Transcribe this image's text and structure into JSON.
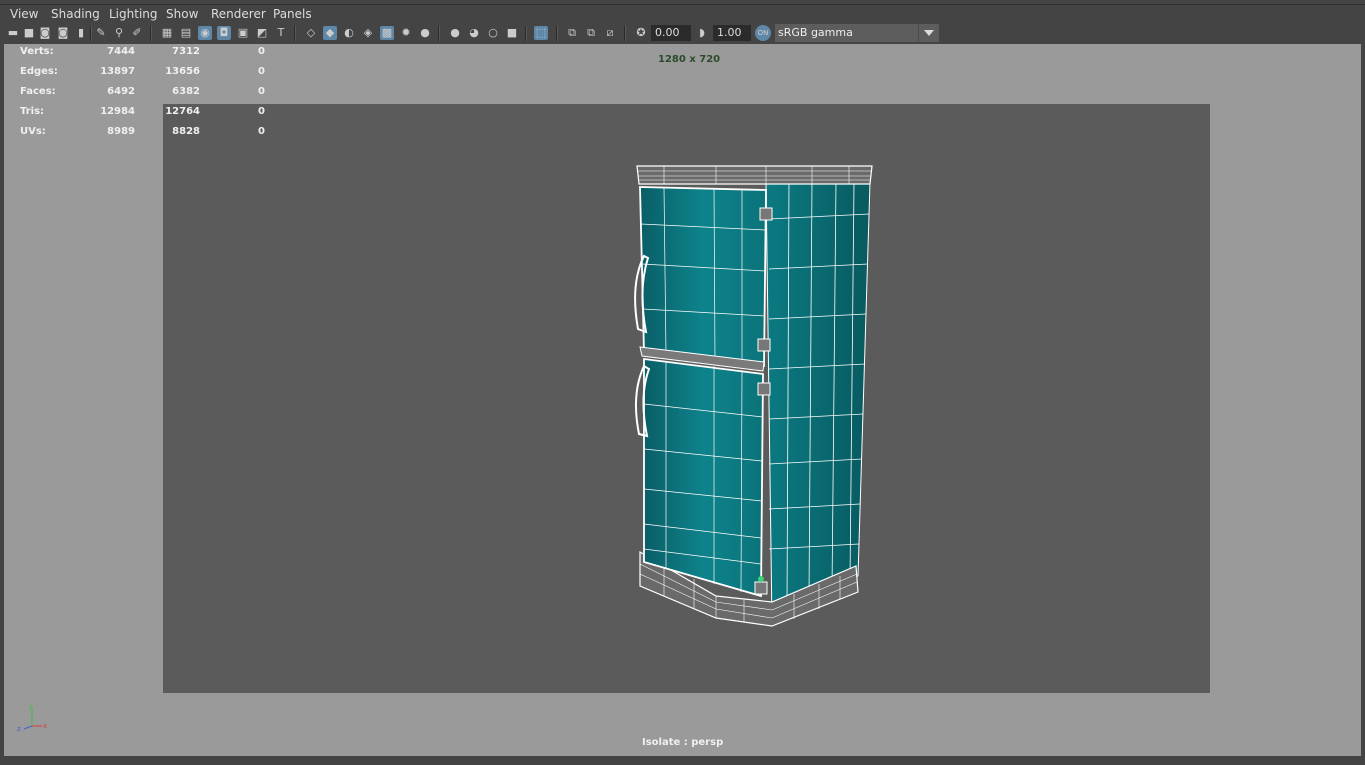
{
  "menu": [
    "View",
    "Shading",
    "Lighting",
    "Show",
    "Renderer",
    "Panels"
  ],
  "toolbar": {
    "exposure_value": "0.00",
    "gamma_value": "1.00",
    "colorspace": "sRGB gamma",
    "icons": [
      "camera-icon",
      "camera-attributes-icon",
      "bookmark-icon",
      "image-plane-icon",
      "grid-icon",
      "film-gate-icon",
      "resolution-gate-icon",
      "safe-action-icon",
      "wireframe-icon",
      "smooth-shade-icon",
      "textured-icon",
      "lights-icon",
      "shadows-icon",
      "xray-icon",
      "isolate-icon",
      "color-management-icon"
    ]
  },
  "hud": {
    "rows": [
      {
        "label": "Verts:",
        "total": "7444",
        "selected": "7312",
        "extra": "0"
      },
      {
        "label": "Edges:",
        "total": "13897",
        "selected": "13656",
        "extra": "0"
      },
      {
        "label": "Faces:",
        "total": "6492",
        "selected": "6382",
        "extra": "0"
      },
      {
        "label": "Tris:",
        "total": "12984",
        "selected": "12764",
        "extra": "0"
      },
      {
        "label": "UVs:",
        "total": "8989",
        "selected": "8828",
        "extra": "0"
      }
    ],
    "resolution": "1280 x 720",
    "camera": "Isolate : persp"
  },
  "colors": {
    "viewport_bg": "#9a9a9a",
    "gate_bg": "#5b5b5b",
    "model_teal": "#0c7a82",
    "wire": "#ffffff"
  }
}
